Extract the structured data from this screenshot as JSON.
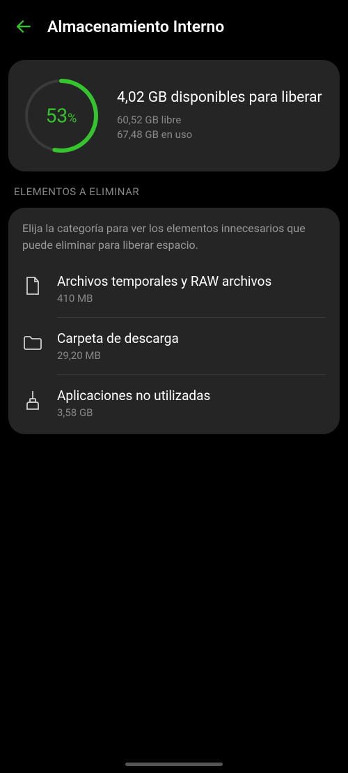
{
  "header": {
    "title": "Almacenamiento Interno"
  },
  "gauge": {
    "percent": 53,
    "percent_label": "53",
    "percent_suffix": "%"
  },
  "storage": {
    "headline": "4,02 GB disponibles para liberar",
    "free": "60,52 GB libre",
    "used": "67,48 GB en uso"
  },
  "section": {
    "title": "ELEMENTOS A ELIMINAR",
    "description": "Elija la categoría para ver los elementos innecesarios que puede eliminar para liberar espacio."
  },
  "items": [
    {
      "title": "Archivos temporales y RAW archivos",
      "sub": "410 MB",
      "icon": "file-icon"
    },
    {
      "title": "Carpeta de descarga",
      "sub": "29,20 MB",
      "icon": "folder-icon"
    },
    {
      "title": "Aplicaciones no utilizadas",
      "sub": "3,58 GB",
      "icon": "broom-icon"
    }
  ],
  "colors": {
    "accent": "#35c42e"
  }
}
